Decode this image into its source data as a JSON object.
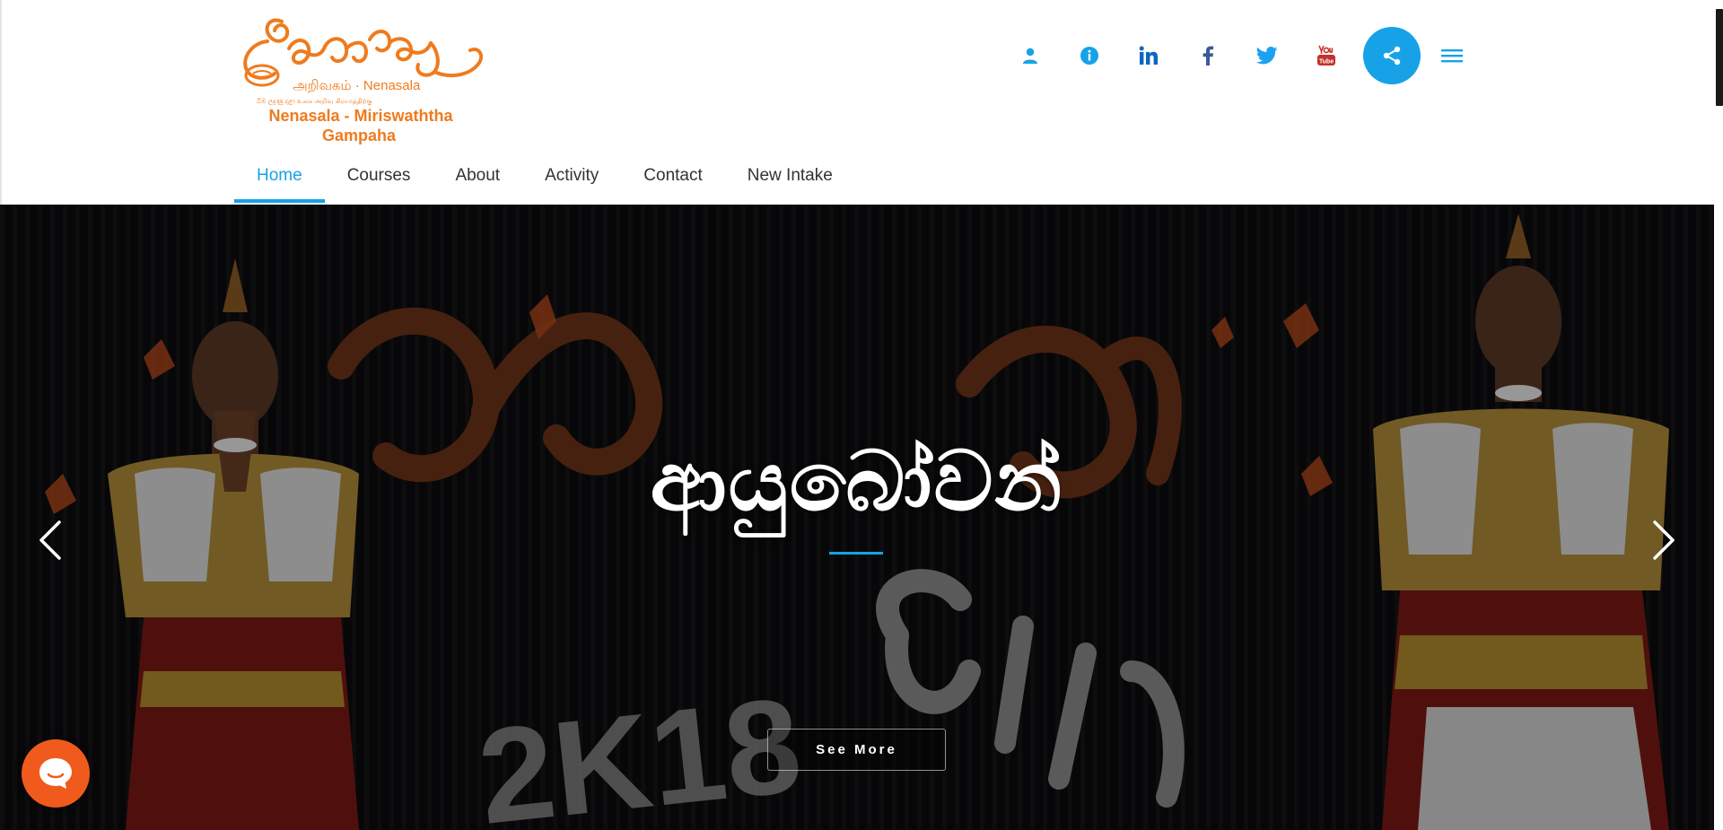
{
  "logo": {
    "tamil_line": "அறிவகம் · Nenasala",
    "tiny_line": "බිඹ ලදුණු දළා  உலக அறிவு கிராமத்திற்கு",
    "name_line": "Nenasala - Miriswaththa",
    "city_line": "Gampaha"
  },
  "top_icons": [
    "user-icon",
    "info-icon",
    "linkedin-icon",
    "facebook-icon",
    "twitter-icon",
    "youtube-icon"
  ],
  "share_icon": "share-icon",
  "menu_icon": "hamburger-menu-icon",
  "nav": {
    "items": [
      {
        "label": "Home",
        "active": true
      },
      {
        "label": "Courses",
        "active": false
      },
      {
        "label": "About",
        "active": false
      },
      {
        "label": "Activity",
        "active": false
      },
      {
        "label": "Contact",
        "active": false
      },
      {
        "label": "New Intake",
        "active": false
      }
    ]
  },
  "hero": {
    "title": "ආයුබෝවන්",
    "button_label": "See More",
    "prev_icon": "chevron-left-icon",
    "next_icon": "chevron-right-icon",
    "backdrop_text": "2K18"
  },
  "chat_icon": "chat-bubble-icon",
  "colors": {
    "accent": "#17a2e8",
    "brand_orange": "#ef7b1e",
    "chat": "#f15a1d",
    "nav_text": "#333333"
  }
}
